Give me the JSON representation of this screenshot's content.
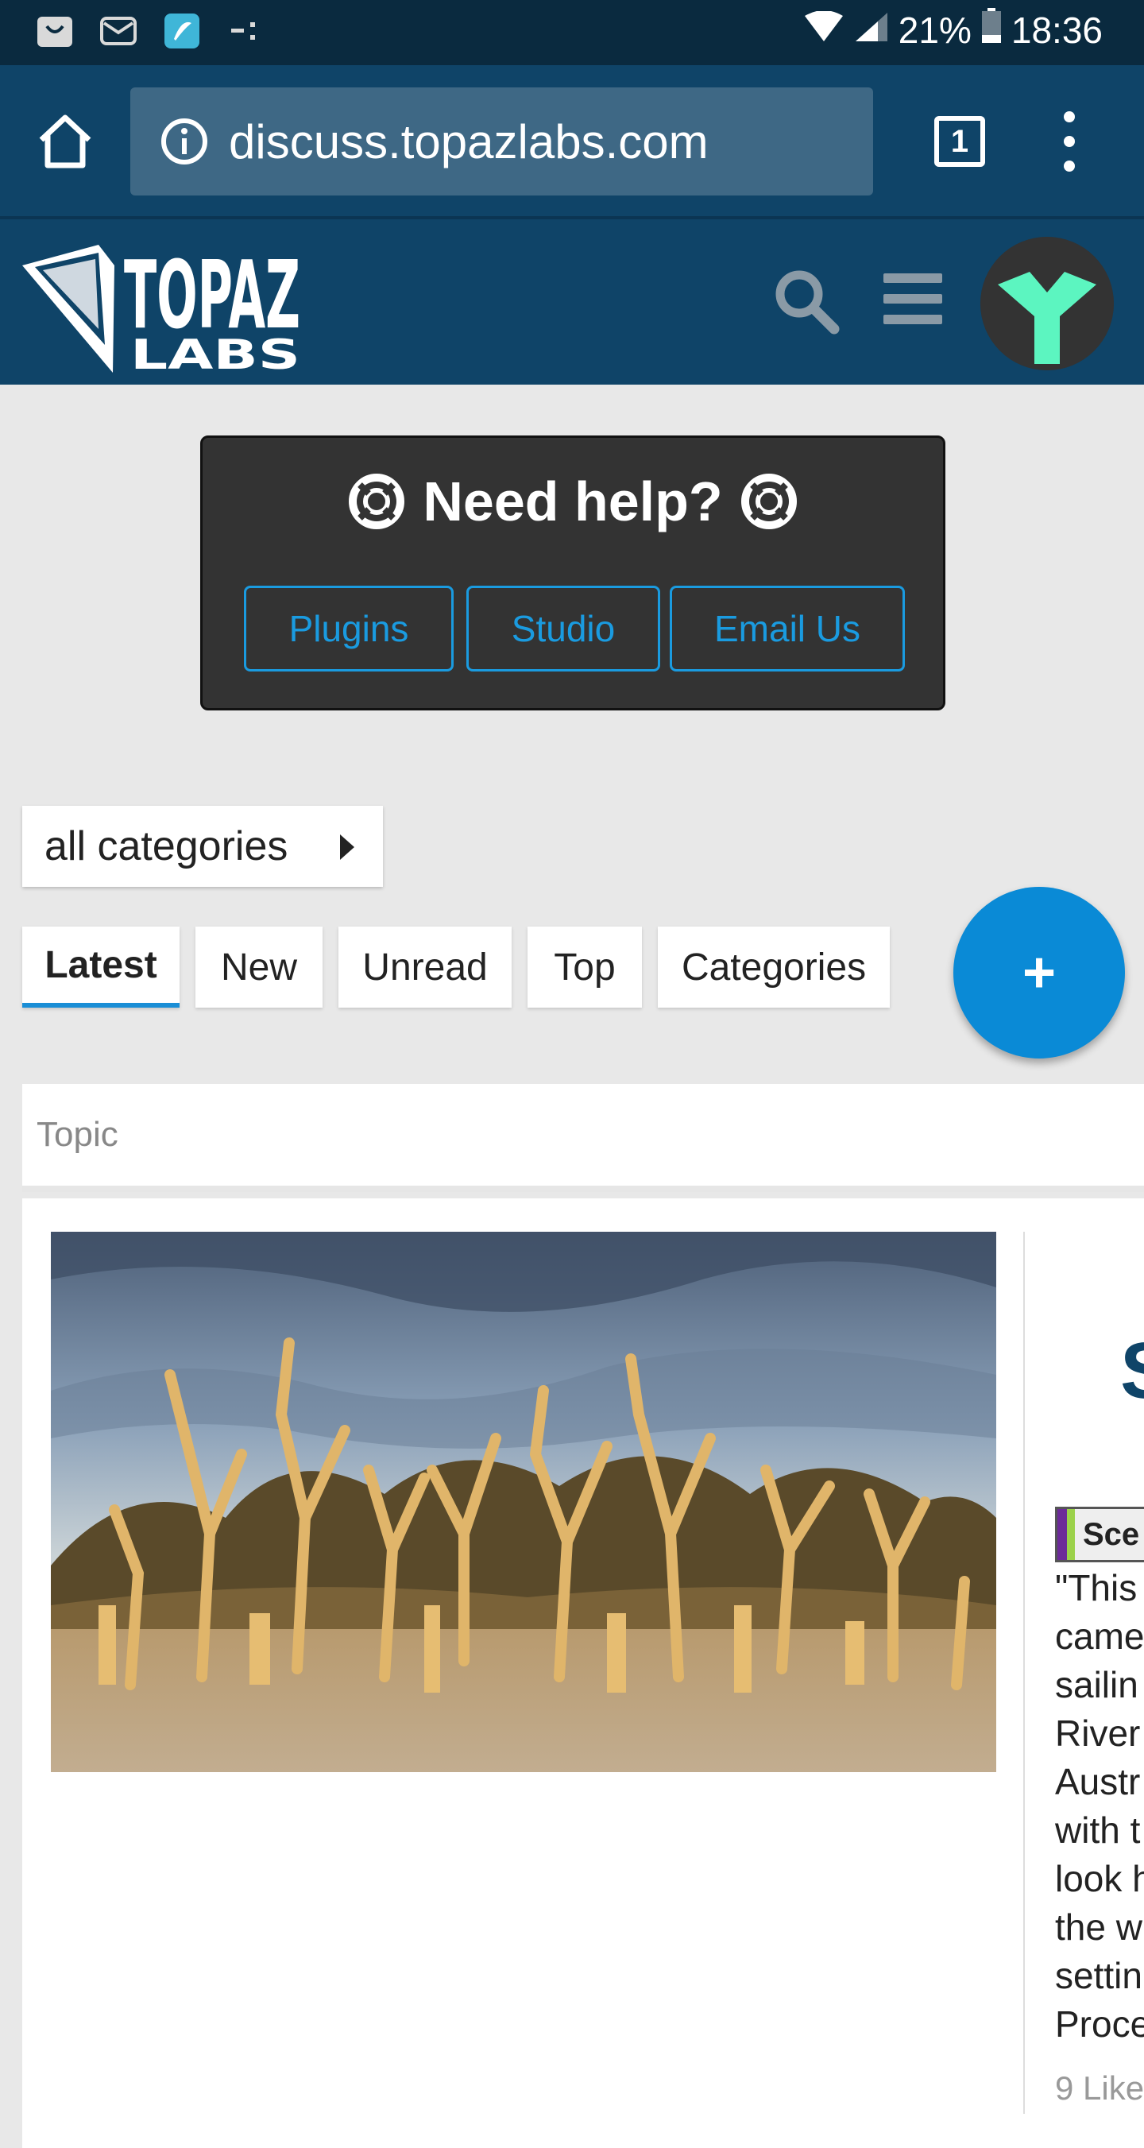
{
  "status_bar": {
    "battery": "21%",
    "time": "18:36"
  },
  "browser": {
    "url": "discuss.topazlabs.com",
    "tab_count": "1"
  },
  "site": {
    "logo_text": "TOPAZ LABS"
  },
  "help": {
    "title": "Need help?",
    "buttons": [
      "Plugins",
      "Studio",
      "Email Us"
    ]
  },
  "categories_dropdown": "all categories",
  "nav_tabs": [
    "Latest",
    "New",
    "Unread",
    "Top",
    "Categories"
  ],
  "fab_label": "+",
  "topic_list": {
    "header": "Topic",
    "topic": {
      "title_fragment": "S",
      "category_fragment": "Sce",
      "excerpt_lines": [
        "\"This",
        "came",
        "sailin",
        "River",
        "Austr",
        "with t",
        "look h",
        "the w",
        "settin",
        "Proce"
      ],
      "likes_fragment": "9 Like"
    }
  },
  "colors": {
    "status_bar": "#0a2a3f",
    "header": "#0f4468",
    "accent": "#1a9be0",
    "fab": "#0a8ad6",
    "avatar_y": "#5cf5c0"
  }
}
